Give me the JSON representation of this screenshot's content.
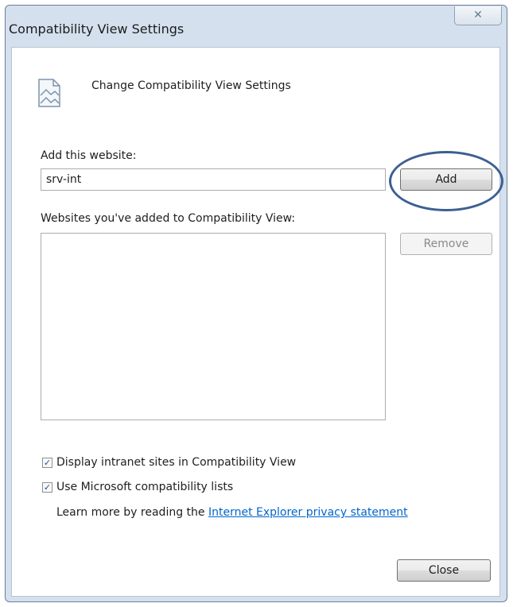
{
  "window": {
    "title": "Compatibility View Settings",
    "close_glyph": "✕"
  },
  "header": {
    "icon": "compatibility-page-icon",
    "text": "Change Compatibility View Settings"
  },
  "add_site": {
    "label": "Add this website:",
    "value": "srv-int",
    "add_button": "Add"
  },
  "list": {
    "label": "Websites you've added to Compatibility View:",
    "items": [],
    "remove_button": "Remove"
  },
  "options": {
    "intranet": {
      "label": "Display intranet sites in Compatibility View",
      "checked": true
    },
    "ms_lists": {
      "label": "Use Microsoft compatibility lists",
      "checked": true
    }
  },
  "learn_more": {
    "text": "Learn more by reading the ",
    "link": "Internet Explorer privacy statement"
  },
  "footer": {
    "close_button": "Close"
  },
  "colors": {
    "annotation_ellipse": "#3c5f92",
    "link": "#0066cc",
    "frame": "#d4e0ee"
  }
}
